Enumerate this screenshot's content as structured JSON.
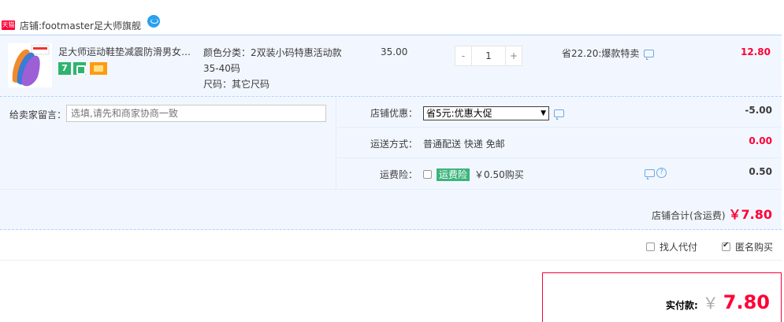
{
  "shop": {
    "badge": "天猫",
    "label": "店铺:",
    "name": "footmaster足大师旗舰"
  },
  "item": {
    "title": "足大师运动鞋垫减震防滑男女防…",
    "sku_line1": "颜色分类：2双装小码特惠活动款",
    "sku_line2": "35-40码",
    "sku_line3": "尺码：其它尺码",
    "price": "35.00",
    "qty_minus": "-",
    "qty_value": "1",
    "qty_plus": "+",
    "promo": "省22.20:爆款特卖",
    "subtotal": "12.80",
    "badge_icon_text": "7"
  },
  "memo": {
    "label": "给卖家留言：",
    "placeholder": "选填,请先和商家协商一致"
  },
  "discount": {
    "label": "店铺优惠：",
    "selected": "省5元:优惠大促",
    "amount": "-5.00"
  },
  "shipping": {
    "label": "运送方式：",
    "value": "普通配送 快递 免邮",
    "amount": "0.00"
  },
  "insurance": {
    "label": "运费险：",
    "tag": "运费险",
    "value": "￥0.50购买",
    "amount": "0.50",
    "help": "?"
  },
  "shop_total": {
    "label": "店铺合计(含运费)",
    "amount": "￥7.80"
  },
  "services": {
    "proxy_pay": "找人代付",
    "anonymous": "匿名购买"
  },
  "pay": {
    "label": "实付款:",
    "yen": "￥",
    "amount": "7.80"
  },
  "colors": {
    "accent": "#ff0036",
    "row_bg": "#f2f7ff",
    "border_blue": "#b2d1ff"
  }
}
